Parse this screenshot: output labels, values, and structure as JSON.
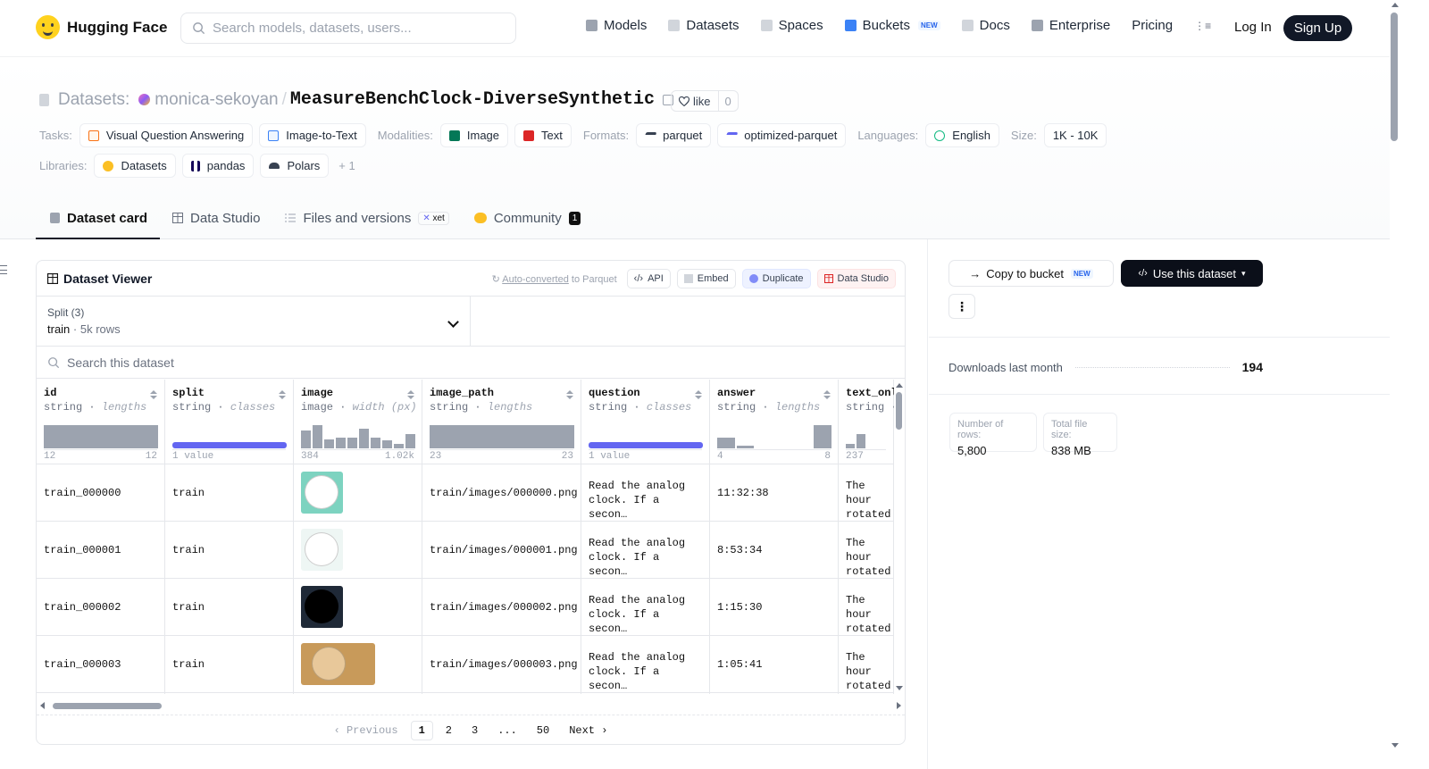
{
  "nav": {
    "logo": "Hugging Face",
    "search_placeholder": "Search models, datasets, users...",
    "links": [
      {
        "label": "Models",
        "icon": "models-icon",
        "color": "#9ca3af"
      },
      {
        "label": "Datasets",
        "icon": "datasets-icon",
        "color": "#d1d5db"
      },
      {
        "label": "Spaces",
        "icon": "spaces-icon",
        "color": "#d1d5db"
      },
      {
        "label": "Buckets",
        "icon": "buckets-icon",
        "color": "#3b82f6",
        "badge": "NEW"
      },
      {
        "label": "Docs",
        "icon": "docs-icon",
        "color": "#d1d5db"
      },
      {
        "label": "Enterprise",
        "icon": "enterprise-icon",
        "color": "#9ca3af"
      },
      {
        "label": "Pricing"
      }
    ],
    "login": "Log In",
    "signup": "Sign Up"
  },
  "header": {
    "section": "Datasets:",
    "owner": "monica-sekoyan",
    "repo": "MeasureBenchClock-DiverseSynthetic",
    "like": "like",
    "like_count": "0",
    "tasks_label": "Tasks:",
    "tasks": [
      "Visual Question Answering",
      "Image-to-Text"
    ],
    "modalities_label": "Modalities:",
    "modalities": [
      "Image",
      "Text"
    ],
    "formats_label": "Formats:",
    "formats": [
      "parquet",
      "optimized-parquet"
    ],
    "languages_label": "Languages:",
    "languages": [
      "English"
    ],
    "size_label": "Size:",
    "size": "1K - 10K",
    "libraries_label": "Libraries:",
    "libraries": [
      "Datasets",
      "pandas",
      "Polars"
    ],
    "libraries_more": "+ 1"
  },
  "tabs": [
    {
      "label": "Dataset card",
      "active": true
    },
    {
      "label": "Data Studio"
    },
    {
      "label": "Files and versions",
      "badge": "xet"
    },
    {
      "label": "Community",
      "count": "1"
    }
  ],
  "viewer": {
    "title": "Dataset Viewer",
    "auto_converted_link": "Auto-converted",
    "auto_converted_rest": " to Parquet",
    "api": "API",
    "embed": "Embed",
    "duplicate": "Duplicate",
    "data_studio": "Data Studio",
    "split_label": "Split (3)",
    "split_value": "train",
    "split_rows": "5k rows",
    "search_placeholder": "Search this dataset",
    "columns": [
      {
        "name": "id",
        "type": "string",
        "stat": "lengths",
        "min": "12",
        "max": "12"
      },
      {
        "name": "split",
        "type": "string",
        "stat": "classes",
        "min": "1 value",
        "max": ""
      },
      {
        "name": "image",
        "type": "image",
        "stat": "width (px)",
        "min": "384",
        "max": "1.02k"
      },
      {
        "name": "image_path",
        "type": "string",
        "stat": "lengths",
        "min": "23",
        "max": "23"
      },
      {
        "name": "question",
        "type": "string",
        "stat": "classes",
        "min": "1 value",
        "max": ""
      },
      {
        "name": "answer",
        "type": "string",
        "stat": "lengths",
        "min": "4",
        "max": "8"
      },
      {
        "name": "text_only",
        "type": "string",
        "stat": "lengths",
        "min": "237",
        "max": ""
      }
    ],
    "image_hist": [
      0.75,
      1.0,
      0.4,
      0.45,
      0.45,
      0.85,
      0.45,
      0.35,
      0.2,
      0.6
    ],
    "answer_hist": [
      0.45,
      0.12,
      0,
      0,
      0,
      1.0
    ],
    "text_hist": [
      0.2,
      0.6
    ],
    "rows": [
      {
        "id": "train_000000",
        "split": "train",
        "thumb": "#7dd3c0",
        "image_path": "train/images/000000.png",
        "question": "Read the analog clock. If a secon…",
        "answer": "11:32:38",
        "text": "The hour rotated"
      },
      {
        "id": "train_000001",
        "split": "train",
        "thumb": "#eef6f4",
        "image_path": "train/images/000001.png",
        "question": "Read the analog clock. If a secon…",
        "answer": "8:53:34",
        "text": "The hour rotated"
      },
      {
        "id": "train_000002",
        "split": "train",
        "thumb": "#1f2937",
        "image_path": "train/images/000002.png",
        "question": "Read the analog clock. If a secon…",
        "answer": "1:15:30",
        "text": "The hour rotated"
      },
      {
        "id": "train_000003",
        "split": "train",
        "thumb": "#c89a5a",
        "image_path": "train/images/000003.png",
        "question": "Read the analog clock. If a secon…",
        "answer": "1:05:41",
        "text": "The hour rotated"
      }
    ],
    "pages": {
      "prev": "Previous",
      "items": [
        "1",
        "2",
        "3",
        "...",
        "50"
      ],
      "current": "1",
      "next": "Next"
    }
  },
  "sidebar": {
    "copy_bucket": "Copy to bucket",
    "copy_badge": "NEW",
    "use_dataset": "Use this dataset",
    "downloads_label": "Downloads last month",
    "downloads": "194",
    "rows_label": "Number of rows:",
    "rows": "5,800",
    "size_label": "Total file size:",
    "size": "838 MB"
  }
}
